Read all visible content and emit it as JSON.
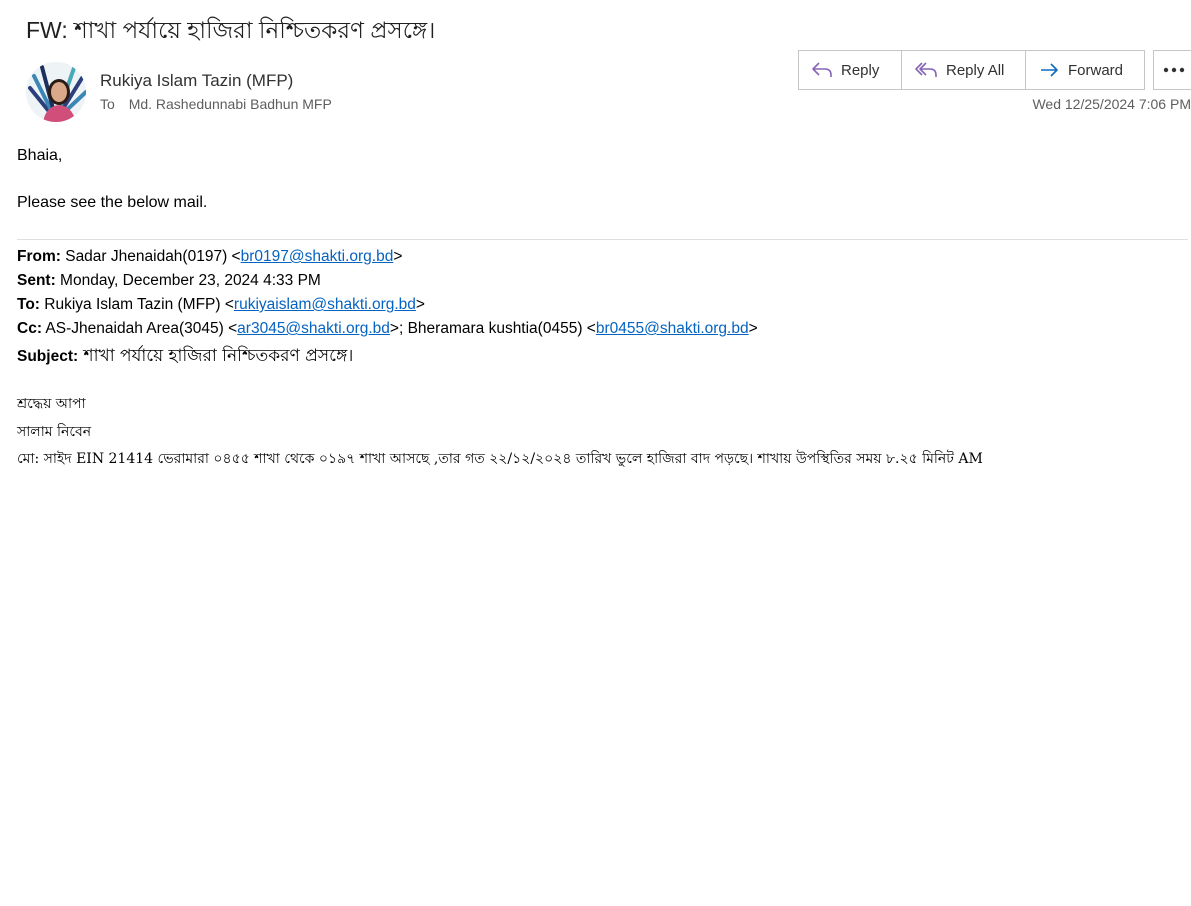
{
  "email": {
    "subject": "FW: শাখা পর্যায়ে হাজিরা নিশ্চিতকরণ প্রসঙ্গে।",
    "sender_name": "Rukiya Islam Tazin (MFP)",
    "to_label": "To",
    "to_value": "Md. Rashedunnabi Badhun MFP",
    "date": "Wed 12/25/2024 7:06 PM"
  },
  "toolbar": {
    "reply_label": "Reply",
    "reply_all_label": "Reply All",
    "forward_label": "Forward",
    "more_label": "More actions",
    "accent_color": "#8764b8"
  },
  "body": {
    "greeting": "Bhaia,",
    "message": "Please see the below mail."
  },
  "forwarded": {
    "from_label": "From:",
    "from_name": " Sadar Jhenaidah(0197) <",
    "from_email": "br0197@shakti.org.bd",
    "from_close": ">",
    "sent_label": "Sent:",
    "sent_value": " Monday, December 23, 2024 4:33 PM",
    "to_label": "To:",
    "to_name": " Rukiya Islam Tazin (MFP) <",
    "to_email": "rukiyaislam@shakti.org.bd",
    "to_close": ">",
    "cc_label": "Cc:",
    "cc_name1": " AS-Jhenaidah Area(3045) <",
    "cc_email1": "ar3045@shakti.org.bd",
    "cc_mid": ">; Bheramara kushtia(0455) <",
    "cc_email2": "br0455@shakti.org.bd",
    "cc_close": ">",
    "subject_label": "Subject:",
    "subject_value": " শাখা পর্যায়ে হাজিরা নিশ্চিতকরণ প্রসঙ্গে।",
    "salutation": "শ্রদ্ধেয় আপা",
    "greeting": "সালাম নিবেন",
    "content": "মো: সাইদ EIN 21414 ভেরামারা ০৪৫৫ শাখা থেকে ০১৯৭ শাখা আসছে ,তার গত ২২/১২/২০২৪ তারিখ ভুলে হাজিরা বাদ পড়ছে। শাখায় উপস্থিতির সময় ৮.২৫ মিনিট AM",
    "link_color": "#0563c1"
  }
}
